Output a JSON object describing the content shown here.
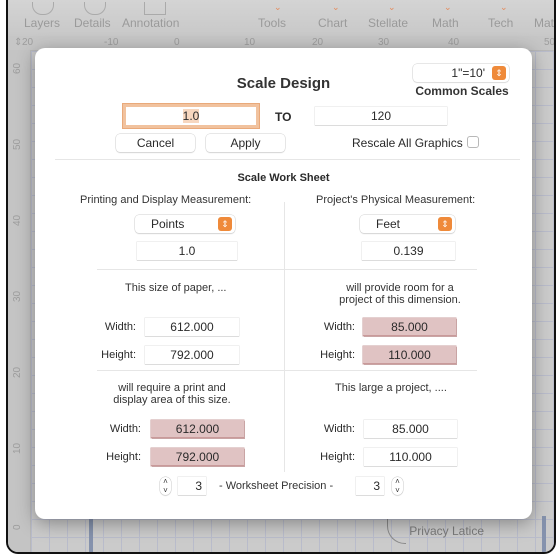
{
  "app": {
    "toolbar": [
      {
        "label": "Layers",
        "icon": "layers-icon"
      },
      {
        "label": "Details",
        "icon": "details-icon"
      },
      {
        "label": "Annotation",
        "icon": "annotation-icon"
      },
      {
        "label": "Tools",
        "icon": "tools-icon"
      },
      {
        "label": "Chart",
        "icon": "chart-icon"
      },
      {
        "label": "Stellate",
        "icon": "stellate-icon"
      },
      {
        "label": "Math",
        "icon": "math-icon"
      },
      {
        "label": "Tech",
        "icon": "tech-icon"
      },
      {
        "label": "Mat",
        "icon": "mat-icon"
      }
    ],
    "ruler_top": [
      "20",
      "-10",
      "0",
      "10",
      "20",
      "30",
      "40",
      "50"
    ],
    "ruler_left": [
      "60",
      "50",
      "40",
      "30",
      "20",
      "10",
      "0"
    ],
    "canvas_label": "Privacy Latice"
  },
  "dialog": {
    "title": "Scale Design",
    "common_scales": {
      "value": "1\"=10'",
      "label": "Common Scales"
    },
    "from_value": "1.0",
    "to_label": "TO",
    "to_value": "120",
    "cancel_label": "Cancel",
    "apply_label": "Apply",
    "rescale_label": "Rescale All Graphics",
    "rescale_checked": false,
    "worksheet": {
      "title": "Scale Work Sheet",
      "left": {
        "heading": "Printing and Display Measurement:",
        "unit": "Points",
        "unit_value": "1.0",
        "paper_text": "This size of paper,   ...",
        "paper_width": "612.000",
        "paper_height": "792.000",
        "require_text_1": "will  require a print and",
        "require_text_2": "display area of  this size.",
        "area_width": "612.000",
        "area_height": "792.000"
      },
      "right": {
        "heading": "Project's Physical Measurement:",
        "unit": "Feet",
        "unit_value": "0.139",
        "room_text_1": "will  provide room for a",
        "room_text_2": "project of this dimension.",
        "room_width": "85.000",
        "room_height": "110.000",
        "large_text": "This large a project,  ....",
        "project_width": "85.000",
        "project_height": "110.000"
      },
      "width_label": "Width:",
      "height_label": "Height:",
      "precision_label": "- Worksheet Precision -",
      "precision_left": "3",
      "precision_right": "3"
    },
    "colors": {
      "accent": "#ef8a3a",
      "computed_field": "#e0c3c3",
      "focus_ring": "#f1c29e"
    }
  }
}
